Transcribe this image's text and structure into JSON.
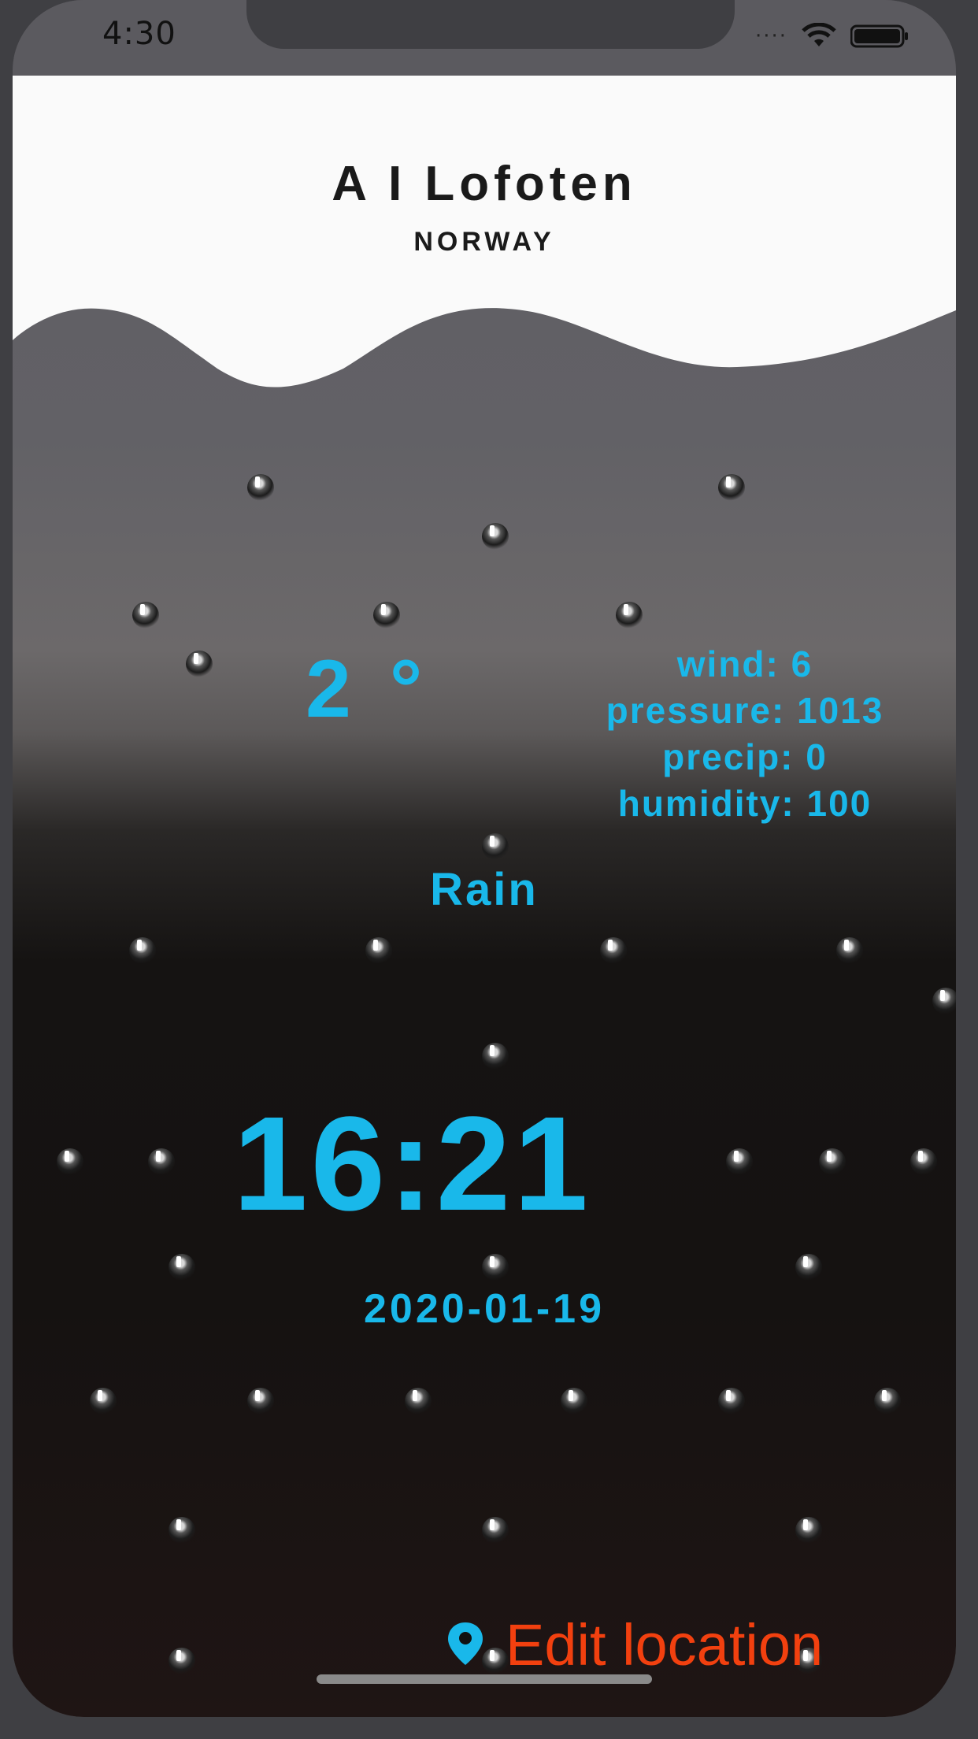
{
  "status_bar": {
    "time": "4:30"
  },
  "location": {
    "city": "A I Lofoten",
    "country": "NORWAY"
  },
  "weather": {
    "temperature": "2 °",
    "stats": [
      "wind: 6",
      "pressure: 1013",
      "precip: 0",
      "humidity: 100"
    ],
    "condition": "Rain"
  },
  "clock": {
    "time": "16:21",
    "date": "2020-01-19"
  },
  "actions": {
    "edit_location": "Edit location"
  },
  "colors": {
    "accent": "#19b8ea",
    "edit_location": "#f2400f",
    "header_bg": "#fafafa",
    "text_dark": "#1a1a1a"
  },
  "icons": {
    "location": "location-pin-icon",
    "wifi": "wifi-icon",
    "battery": "battery-icon",
    "rain": "raindrop-icon"
  }
}
